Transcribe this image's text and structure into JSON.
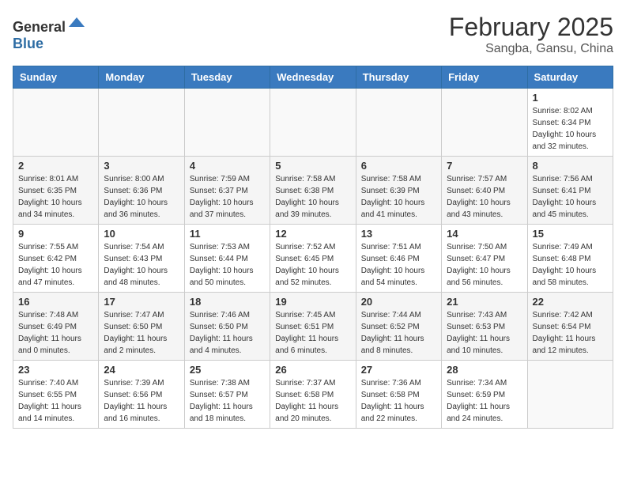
{
  "header": {
    "logo_general": "General",
    "logo_blue": "Blue",
    "month_title": "February 2025",
    "location": "Sangba, Gansu, China"
  },
  "days_of_week": [
    "Sunday",
    "Monday",
    "Tuesday",
    "Wednesday",
    "Thursday",
    "Friday",
    "Saturday"
  ],
  "weeks": [
    [
      {
        "day": "",
        "detail": ""
      },
      {
        "day": "",
        "detail": ""
      },
      {
        "day": "",
        "detail": ""
      },
      {
        "day": "",
        "detail": ""
      },
      {
        "day": "",
        "detail": ""
      },
      {
        "day": "",
        "detail": ""
      },
      {
        "day": "1",
        "detail": "Sunrise: 8:02 AM\nSunset: 6:34 PM\nDaylight: 10 hours and 32 minutes."
      }
    ],
    [
      {
        "day": "2",
        "detail": "Sunrise: 8:01 AM\nSunset: 6:35 PM\nDaylight: 10 hours and 34 minutes."
      },
      {
        "day": "3",
        "detail": "Sunrise: 8:00 AM\nSunset: 6:36 PM\nDaylight: 10 hours and 36 minutes."
      },
      {
        "day": "4",
        "detail": "Sunrise: 7:59 AM\nSunset: 6:37 PM\nDaylight: 10 hours and 37 minutes."
      },
      {
        "day": "5",
        "detail": "Sunrise: 7:58 AM\nSunset: 6:38 PM\nDaylight: 10 hours and 39 minutes."
      },
      {
        "day": "6",
        "detail": "Sunrise: 7:58 AM\nSunset: 6:39 PM\nDaylight: 10 hours and 41 minutes."
      },
      {
        "day": "7",
        "detail": "Sunrise: 7:57 AM\nSunset: 6:40 PM\nDaylight: 10 hours and 43 minutes."
      },
      {
        "day": "8",
        "detail": "Sunrise: 7:56 AM\nSunset: 6:41 PM\nDaylight: 10 hours and 45 minutes."
      }
    ],
    [
      {
        "day": "9",
        "detail": "Sunrise: 7:55 AM\nSunset: 6:42 PM\nDaylight: 10 hours and 47 minutes."
      },
      {
        "day": "10",
        "detail": "Sunrise: 7:54 AM\nSunset: 6:43 PM\nDaylight: 10 hours and 48 minutes."
      },
      {
        "day": "11",
        "detail": "Sunrise: 7:53 AM\nSunset: 6:44 PM\nDaylight: 10 hours and 50 minutes."
      },
      {
        "day": "12",
        "detail": "Sunrise: 7:52 AM\nSunset: 6:45 PM\nDaylight: 10 hours and 52 minutes."
      },
      {
        "day": "13",
        "detail": "Sunrise: 7:51 AM\nSunset: 6:46 PM\nDaylight: 10 hours and 54 minutes."
      },
      {
        "day": "14",
        "detail": "Sunrise: 7:50 AM\nSunset: 6:47 PM\nDaylight: 10 hours and 56 minutes."
      },
      {
        "day": "15",
        "detail": "Sunrise: 7:49 AM\nSunset: 6:48 PM\nDaylight: 10 hours and 58 minutes."
      }
    ],
    [
      {
        "day": "16",
        "detail": "Sunrise: 7:48 AM\nSunset: 6:49 PM\nDaylight: 11 hours and 0 minutes."
      },
      {
        "day": "17",
        "detail": "Sunrise: 7:47 AM\nSunset: 6:50 PM\nDaylight: 11 hours and 2 minutes."
      },
      {
        "day": "18",
        "detail": "Sunrise: 7:46 AM\nSunset: 6:50 PM\nDaylight: 11 hours and 4 minutes."
      },
      {
        "day": "19",
        "detail": "Sunrise: 7:45 AM\nSunset: 6:51 PM\nDaylight: 11 hours and 6 minutes."
      },
      {
        "day": "20",
        "detail": "Sunrise: 7:44 AM\nSunset: 6:52 PM\nDaylight: 11 hours and 8 minutes."
      },
      {
        "day": "21",
        "detail": "Sunrise: 7:43 AM\nSunset: 6:53 PM\nDaylight: 11 hours and 10 minutes."
      },
      {
        "day": "22",
        "detail": "Sunrise: 7:42 AM\nSunset: 6:54 PM\nDaylight: 11 hours and 12 minutes."
      }
    ],
    [
      {
        "day": "23",
        "detail": "Sunrise: 7:40 AM\nSunset: 6:55 PM\nDaylight: 11 hours and 14 minutes."
      },
      {
        "day": "24",
        "detail": "Sunrise: 7:39 AM\nSunset: 6:56 PM\nDaylight: 11 hours and 16 minutes."
      },
      {
        "day": "25",
        "detail": "Sunrise: 7:38 AM\nSunset: 6:57 PM\nDaylight: 11 hours and 18 minutes."
      },
      {
        "day": "26",
        "detail": "Sunrise: 7:37 AM\nSunset: 6:58 PM\nDaylight: 11 hours and 20 minutes."
      },
      {
        "day": "27",
        "detail": "Sunrise: 7:36 AM\nSunset: 6:58 PM\nDaylight: 11 hours and 22 minutes."
      },
      {
        "day": "28",
        "detail": "Sunrise: 7:34 AM\nSunset: 6:59 PM\nDaylight: 11 hours and 24 minutes."
      },
      {
        "day": "",
        "detail": ""
      }
    ]
  ]
}
